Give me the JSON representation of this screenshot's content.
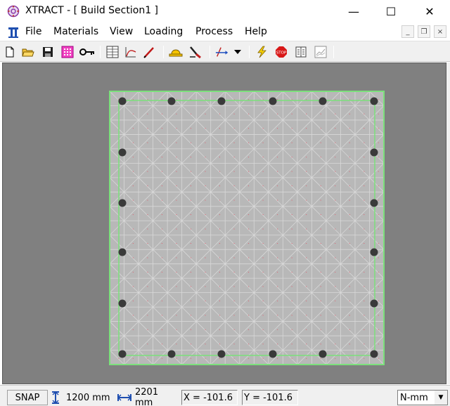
{
  "window": {
    "title": "XTRACT - [ Build Section1 ]",
    "min_glyph": "—",
    "max_glyph": "☐",
    "close_glyph": "✕"
  },
  "menu": {
    "items": [
      "File",
      "Materials",
      "View",
      "Loading",
      "Process",
      "Help"
    ],
    "mdi_min": "_",
    "mdi_restore": "❐",
    "mdi_close": "×"
  },
  "toolbar": {
    "icons": [
      "new-file-icon",
      "open-folder-icon",
      "save-icon",
      "mesh-grid-icon",
      "key-icon",
      "section-grid-icon",
      "curve-icon",
      "line-draw-icon",
      "hat-icon",
      "dig-tool-icon",
      "axis-transform-icon",
      "dropdown-arrow-icon",
      "lightning-icon",
      "stop-icon",
      "report-icon",
      "chart-icon"
    ]
  },
  "section": {
    "outline_color": "#7be07b",
    "fill_color": "#b8b8b8",
    "mesh_color": "#d8d8d8",
    "rebar_color": "#3a3a3a"
  },
  "status": {
    "snap": "SNAP",
    "height": "1200 mm",
    "width": "2201 mm",
    "x_readout": "X = -101.6",
    "y_readout": "Y = -101.6",
    "units": "N-mm"
  }
}
